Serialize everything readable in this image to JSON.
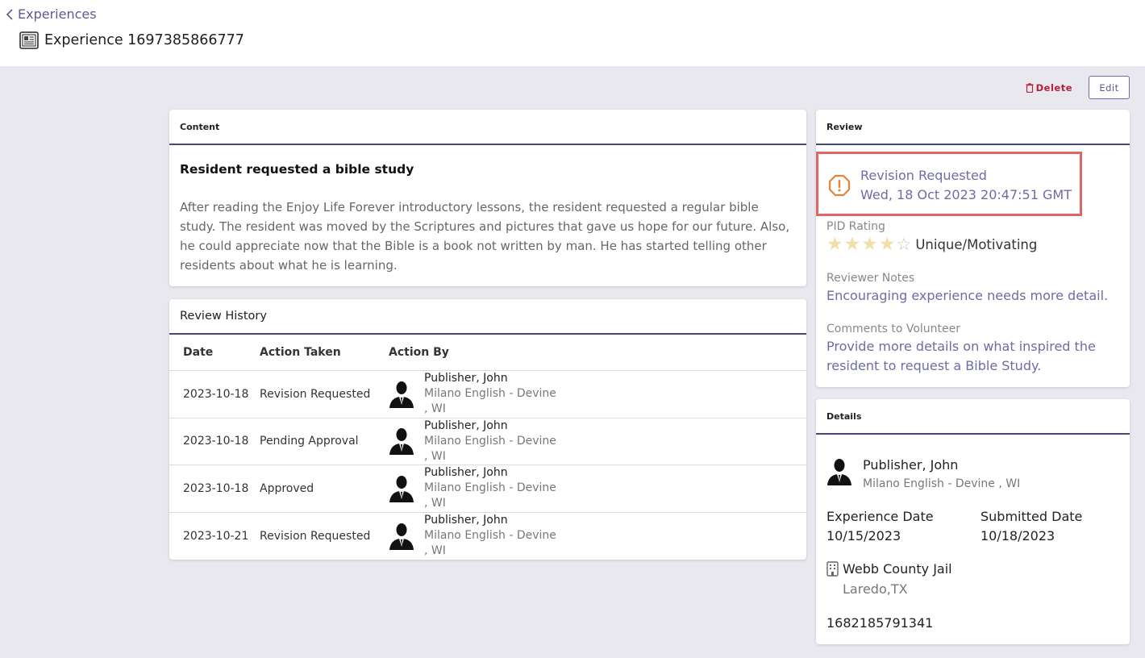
{
  "nav": {
    "back_label": "Experiences"
  },
  "page": {
    "title": "Experience 1697385866777"
  },
  "actions": {
    "delete_label": "Delete",
    "edit_label": "Edit"
  },
  "content_card": {
    "header": "Content",
    "title": "Resident requested a bible study",
    "body": "After reading the Enjoy Life Forever introductory lessons, the resident requested a regular bible study. The resident was moved by the Scriptures and pictures that gave us hope for our future. Also, he could appreciate now that the Bible is a book not written by man. He has started telling other residents about what he is learning."
  },
  "history": {
    "header": "Review History",
    "columns": [
      "Date",
      "Action Taken",
      "Action By"
    ],
    "rows": [
      {
        "date": "2023-10-18",
        "action": "Revision Requested",
        "by_name": "Publisher, John",
        "by_cong": "Milano English - Devine",
        "by_state": ", WI"
      },
      {
        "date": "2023-10-18",
        "action": "Pending Approval",
        "by_name": "Publisher, John",
        "by_cong": "Milano English - Devine",
        "by_state": ", WI"
      },
      {
        "date": "2023-10-18",
        "action": "Approved",
        "by_name": "Publisher, John",
        "by_cong": "Milano English - Devine",
        "by_state": ", WI"
      },
      {
        "date": "2023-10-21",
        "action": "Revision Requested",
        "by_name": "Publisher, John",
        "by_cong": "Milano English - Devine",
        "by_state": ", WI"
      }
    ]
  },
  "review": {
    "header": "Review",
    "status": "Revision Requested",
    "status_date": "Wed, 18 Oct 2023 20:47:51 GMT",
    "pid_rating_label": "PID Rating",
    "rating_value": 4,
    "rating_max": 5,
    "rating_text": "Unique/Motivating",
    "reviewer_notes_label": "Reviewer Notes",
    "reviewer_notes": "Encouraging experience needs more detail.",
    "comments_label": "Comments to Volunteer",
    "comments": "Provide more details on what inspired the resident to request a Bible Study."
  },
  "details": {
    "header": "Details",
    "publisher_name": "Publisher, John",
    "congregation": "Milano English - Devine , WI",
    "experience_date_label": "Experience Date",
    "experience_date": "10/15/2023",
    "submitted_date_label": "Submitted Date",
    "submitted_date": "10/18/2023",
    "location_name": "Webb County Jail",
    "location_city": "Laredo,TX",
    "id": "1682185791341"
  },
  "colors": {
    "accent": "#5c5a93",
    "danger": "#b5213a",
    "highlight": "#e06663",
    "warning": "#e8833a",
    "star": "#f1dfa8"
  },
  "icons": {
    "back": "chevron-left-icon",
    "title": "newspaper-icon",
    "delete": "trash-icon",
    "status": "warning-octagon-icon",
    "avatar": "person-silhouette-icon",
    "location": "building-icon"
  }
}
